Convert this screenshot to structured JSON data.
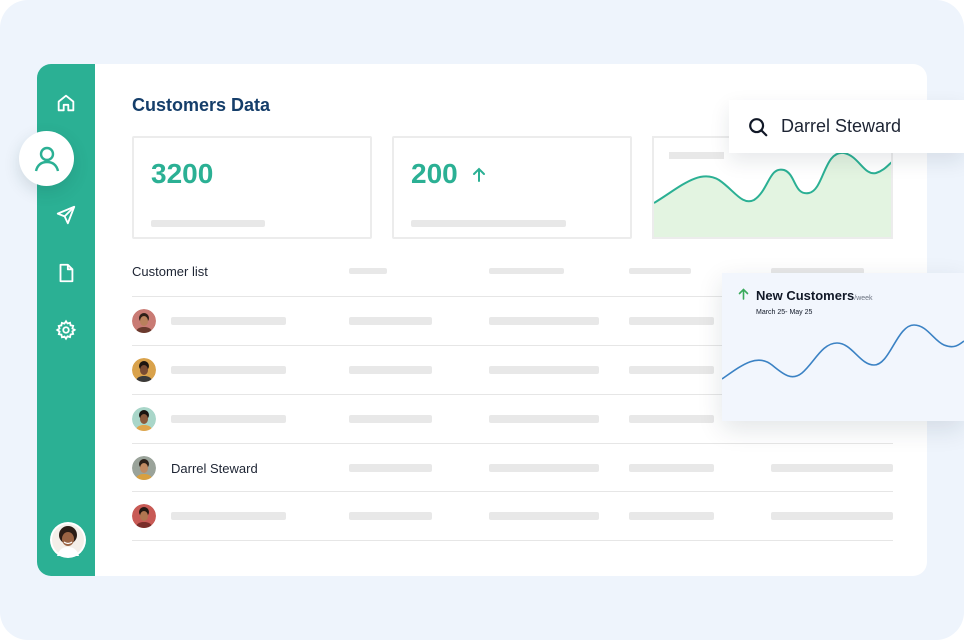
{
  "page": {
    "title": "Customers Data"
  },
  "sidebar": {
    "items": [
      {
        "icon": "home-icon"
      },
      {
        "icon": "user-icon",
        "active": true
      },
      {
        "icon": "send-icon"
      },
      {
        "icon": "document-icon"
      },
      {
        "icon": "settings-icon"
      }
    ],
    "accent": "#2bb094"
  },
  "stats": {
    "total": "3200",
    "new": "200",
    "new_trend": "up"
  },
  "search": {
    "value": "Darrel Steward"
  },
  "customer_list": {
    "title": "Customer list",
    "rows": [
      {
        "name": "",
        "avatar": "avatar-1"
      },
      {
        "name": "",
        "avatar": "avatar-2"
      },
      {
        "name": "",
        "avatar": "avatar-3"
      },
      {
        "name": "Darrel Steward",
        "avatar": "avatar-4"
      },
      {
        "name": "",
        "avatar": "avatar-5"
      }
    ]
  },
  "new_customers_popup": {
    "title": "New Customers",
    "unit": "/week",
    "range": "March 25- May 25"
  },
  "colors": {
    "accent": "#2bb094",
    "title": "#153e6a",
    "background": "#eef4fc",
    "chart_line": "#3b82c4",
    "chart_fill": "#e3f4e1",
    "arrow_green": "#3aaa5c"
  }
}
